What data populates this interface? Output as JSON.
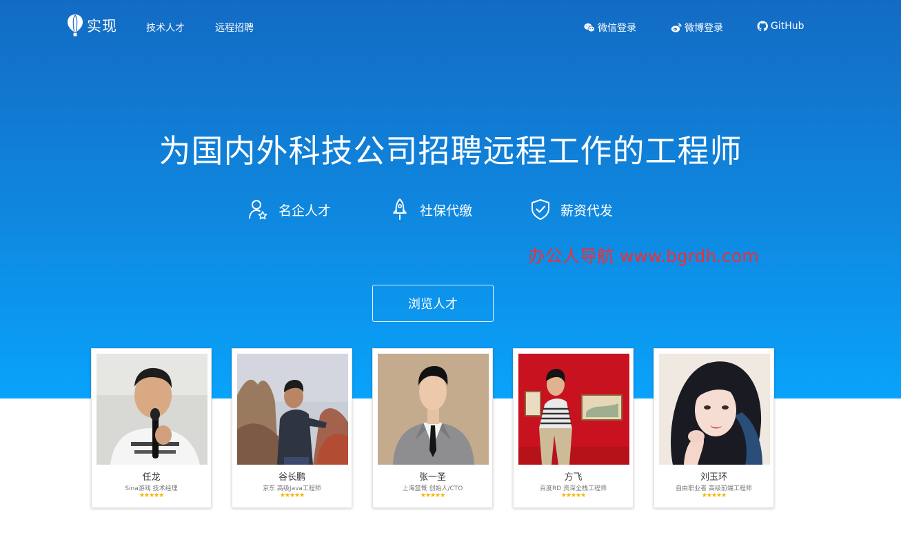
{
  "nav": {
    "logo_text": "实现",
    "links": [
      "技术人才",
      "远程招聘"
    ],
    "wechat_login": "微信登录",
    "weibo_login": "微博登录",
    "github": "GitHub"
  },
  "hero": {
    "headline": "为国内外科技公司招聘远程工作的工程师",
    "features": [
      "名企人才",
      "社保代缴",
      "薪资代发"
    ],
    "watermark": "办公人导航 www.bgrdh.com",
    "browse_button": "浏览人才"
  },
  "cards": [
    {
      "name": "任龙",
      "title": "Sina游戏   技术经理",
      "stars": "★★★★★"
    },
    {
      "name": "谷长鹏",
      "title": "京东   高级Java工程师",
      "stars": "★★★★★"
    },
    {
      "name": "张一圣",
      "title": "上海筮慨   创始人/CTO",
      "stars": "★★★★★"
    },
    {
      "name": "方飞",
      "title": "百度RD   资深全栈工程师",
      "stars": "★★★★★"
    },
    {
      "name": "刘玉环",
      "title": "自由职业者   高级前端工程师",
      "stars": "★★★★★"
    }
  ],
  "colors": {
    "hero_top": "#136bc4",
    "hero_bottom": "#09a3fb",
    "watermark": "#ef2f35",
    "star": "#f5b400"
  }
}
